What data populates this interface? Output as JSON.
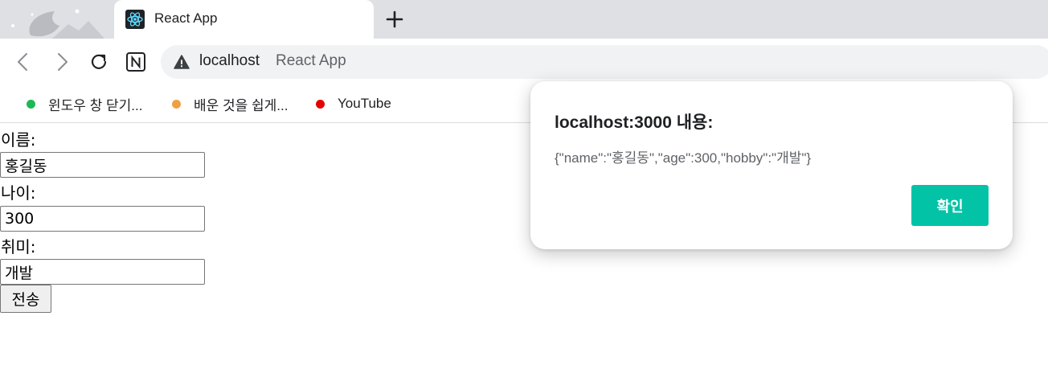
{
  "tab": {
    "title": "React App"
  },
  "toolbar": {
    "host": "localhost",
    "page_title": "React App"
  },
  "bookmarks": [
    {
      "label": "윈도우 창 닫기...",
      "color": "#1db954"
    },
    {
      "label": "배운 것을 쉽게...",
      "color": "#f0a040"
    },
    {
      "label": "YouTube",
      "color": "#e60000"
    }
  ],
  "form": {
    "name_label": "이름:",
    "name_value": "홍길동",
    "age_label": "나이:",
    "age_value": "300",
    "hobby_label": "취미:",
    "hobby_value": "개발",
    "submit_label": "전송"
  },
  "dialog": {
    "title": "localhost:3000 내용:",
    "message": "{\"name\":\"홍길동\",\"age\":300,\"hobby\":\"개발\"}",
    "ok_label": "확인",
    "ok_color": "#03c3a6"
  }
}
